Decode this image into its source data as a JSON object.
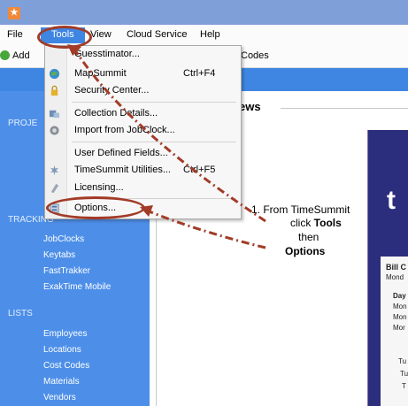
{
  "menubar": {
    "items": [
      "File",
      "Tools",
      "View",
      "Cloud Service",
      "Help"
    ]
  },
  "toolbar": {
    "add_label": "Add",
    "codes_label": "Codes"
  },
  "sidebar": {
    "sections": {
      "projects": "PROJE",
      "tracking": "TRACKING",
      "lists": "LISTS"
    },
    "tracking_items": [
      "JobClocks",
      "Keytabs",
      "FastTrakker",
      "ExakTime Mobile"
    ],
    "list_items": [
      "Employees",
      "Locations",
      "Cost Codes",
      "Materials",
      "Vendors"
    ]
  },
  "main": {
    "news_title": "ews",
    "promo_letter": "t",
    "card_lines": [
      "Bill C",
      "Mond",
      "Day",
      "Mon",
      "Mon",
      "Mor",
      "Tu",
      "Tu",
      "T"
    ]
  },
  "tools_menu": {
    "items": [
      {
        "label": "Guesstimator...",
        "shortcut": "",
        "icon": "calculator-icon"
      },
      {
        "label": "MapSummit",
        "shortcut": "Ctrl+F4",
        "icon": "globe-icon"
      },
      {
        "label": "Security Center...",
        "shortcut": "",
        "icon": "lock-icon"
      },
      {
        "label": "Collection Details...",
        "shortcut": "",
        "icon": "collection-icon"
      },
      {
        "label": "Import from JobClock...",
        "shortcut": "",
        "icon": "import-icon"
      },
      {
        "label": "User Defined Fields...",
        "shortcut": "",
        "icon": ""
      },
      {
        "label": "TimeSummit Utilities...",
        "shortcut": "Ctrl+F5",
        "icon": "utilities-icon"
      },
      {
        "label": "Licensing...",
        "shortcut": "",
        "icon": "license-icon"
      },
      {
        "label": "Options...",
        "shortcut": "",
        "icon": "options-icon"
      }
    ]
  },
  "annotation": {
    "line1": "1. From TimeSummit",
    "click_pre": "click ",
    "click_bold": "Tools",
    "then": "then",
    "options": "Options"
  },
  "colors": {
    "titlebar": "#7f9fd8",
    "sidebar": "#4d8fe8",
    "annotation_arrow": "#a23b27",
    "promo": "#2b2e7c"
  }
}
